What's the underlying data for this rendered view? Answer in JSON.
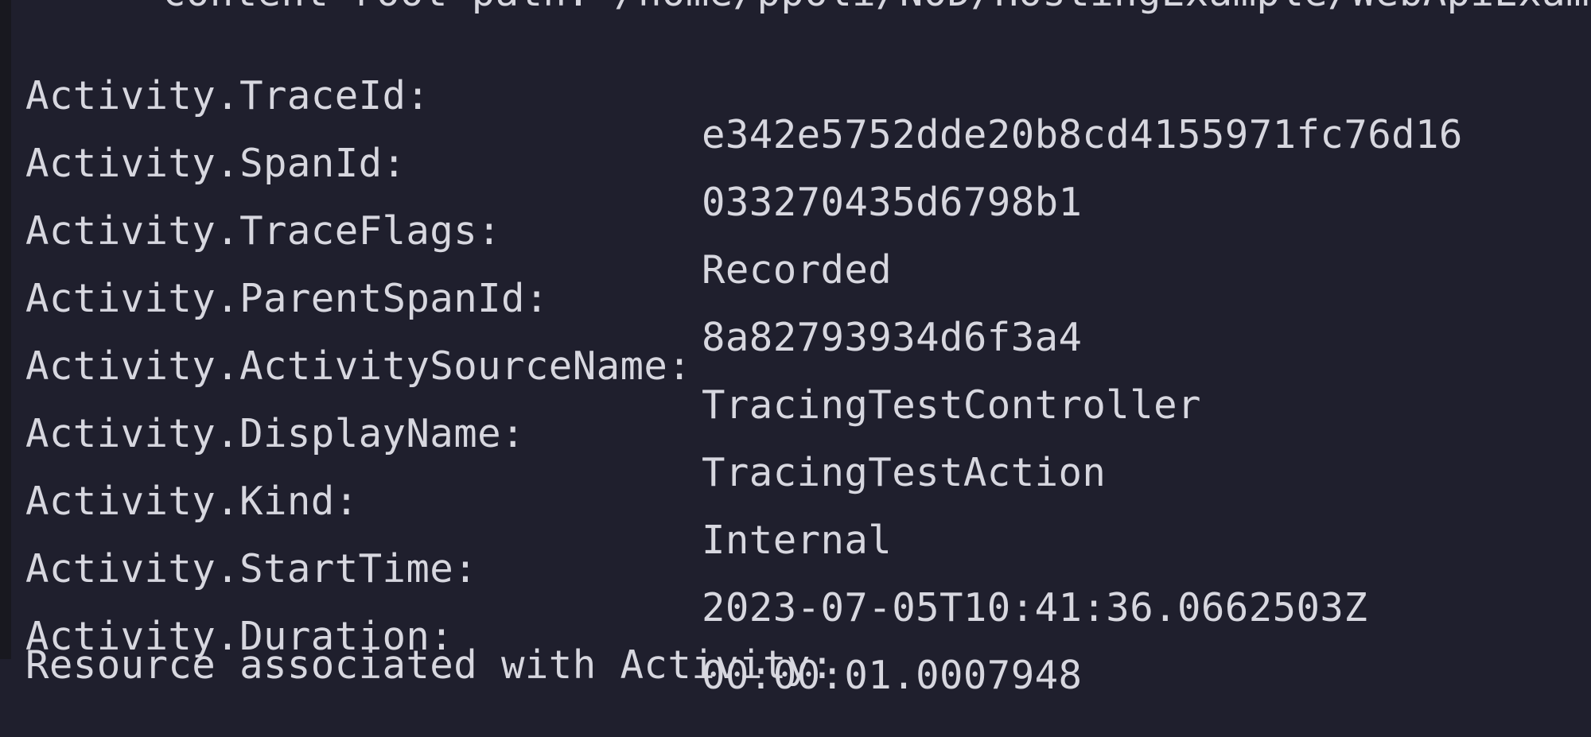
{
  "terminal": {
    "top_partial_text": "content root path: /home/ppoli/NOD/HostingExample/WebApiExample",
    "fields": [
      {
        "key": "Activity.TraceId:",
        "value": "e342e5752dde20b8cd4155971fc76d16"
      },
      {
        "key": "Activity.SpanId:",
        "value": "033270435d6798b1"
      },
      {
        "key": "Activity.TraceFlags:",
        "value": "Recorded"
      },
      {
        "key": "Activity.ParentSpanId:",
        "value": "8a82793934d6f3a4"
      },
      {
        "key": "Activity.ActivitySourceName:",
        "value": "TracingTestController"
      },
      {
        "key": "Activity.DisplayName:",
        "value": "TracingTestAction"
      },
      {
        "key": "Activity.Kind:",
        "value": "Internal"
      },
      {
        "key": "Activity.StartTime:",
        "value": "2023-07-05T10:41:36.0662503Z"
      },
      {
        "key": "Activity.Duration:",
        "value": "00:00:01.0007948"
      }
    ],
    "bottom_partial_text": "Resource associated with Activity:"
  }
}
